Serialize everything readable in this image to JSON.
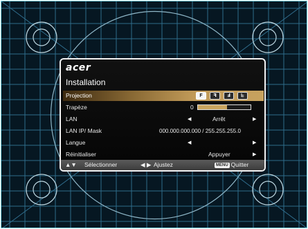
{
  "osd": {
    "brand": "acer",
    "title": "Installation",
    "items": [
      {
        "label": "Projection"
      },
      {
        "label": "Trapèze",
        "value": "0",
        "level": 0.55
      },
      {
        "label": "LAN",
        "value": "Arrêt"
      },
      {
        "label": "LAN IP/ Mask",
        "value": "000.000.000.000 / 255.255.255.0"
      },
      {
        "label": "Langue"
      },
      {
        "label": "Réinitialiser",
        "value": "Appuyer"
      }
    ],
    "projection_modes": [
      "front-projection-icon",
      "rear-projection-icon",
      "ceiling-projection-icon",
      "rear-ceiling-projection-icon"
    ],
    "selected_index": 0
  },
  "footer": {
    "select": "Sélectionner",
    "adjust": "Ajustez",
    "menu_key": "MENU",
    "quit": "Quitter"
  },
  "colors": {
    "highlight": "#c19a58",
    "grid": "#2f6c8b",
    "background": "#061722"
  }
}
